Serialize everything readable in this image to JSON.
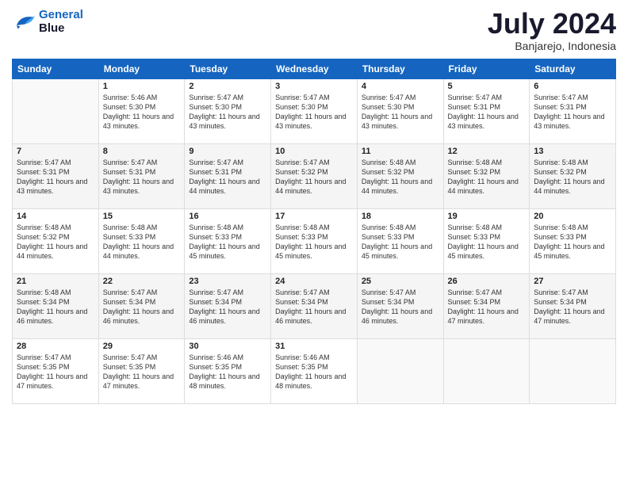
{
  "header": {
    "logo_line1": "General",
    "logo_line2": "Blue",
    "month": "July 2024",
    "location": "Banjarejo, Indonesia"
  },
  "days_of_week": [
    "Sunday",
    "Monday",
    "Tuesday",
    "Wednesday",
    "Thursday",
    "Friday",
    "Saturday"
  ],
  "weeks": [
    [
      {
        "day": "",
        "empty": true
      },
      {
        "day": "1",
        "sunrise": "Sunrise: 5:46 AM",
        "sunset": "Sunset: 5:30 PM",
        "daylight": "Daylight: 11 hours and 43 minutes."
      },
      {
        "day": "2",
        "sunrise": "Sunrise: 5:47 AM",
        "sunset": "Sunset: 5:30 PM",
        "daylight": "Daylight: 11 hours and 43 minutes."
      },
      {
        "day": "3",
        "sunrise": "Sunrise: 5:47 AM",
        "sunset": "Sunset: 5:30 PM",
        "daylight": "Daylight: 11 hours and 43 minutes."
      },
      {
        "day": "4",
        "sunrise": "Sunrise: 5:47 AM",
        "sunset": "Sunset: 5:30 PM",
        "daylight": "Daylight: 11 hours and 43 minutes."
      },
      {
        "day": "5",
        "sunrise": "Sunrise: 5:47 AM",
        "sunset": "Sunset: 5:31 PM",
        "daylight": "Daylight: 11 hours and 43 minutes."
      },
      {
        "day": "6",
        "sunrise": "Sunrise: 5:47 AM",
        "sunset": "Sunset: 5:31 PM",
        "daylight": "Daylight: 11 hours and 43 minutes."
      }
    ],
    [
      {
        "day": "7",
        "sunrise": "Sunrise: 5:47 AM",
        "sunset": "Sunset: 5:31 PM",
        "daylight": "Daylight: 11 hours and 43 minutes."
      },
      {
        "day": "8",
        "sunrise": "Sunrise: 5:47 AM",
        "sunset": "Sunset: 5:31 PM",
        "daylight": "Daylight: 11 hours and 43 minutes."
      },
      {
        "day": "9",
        "sunrise": "Sunrise: 5:47 AM",
        "sunset": "Sunset: 5:31 PM",
        "daylight": "Daylight: 11 hours and 44 minutes."
      },
      {
        "day": "10",
        "sunrise": "Sunrise: 5:47 AM",
        "sunset": "Sunset: 5:32 PM",
        "daylight": "Daylight: 11 hours and 44 minutes."
      },
      {
        "day": "11",
        "sunrise": "Sunrise: 5:48 AM",
        "sunset": "Sunset: 5:32 PM",
        "daylight": "Daylight: 11 hours and 44 minutes."
      },
      {
        "day": "12",
        "sunrise": "Sunrise: 5:48 AM",
        "sunset": "Sunset: 5:32 PM",
        "daylight": "Daylight: 11 hours and 44 minutes."
      },
      {
        "day": "13",
        "sunrise": "Sunrise: 5:48 AM",
        "sunset": "Sunset: 5:32 PM",
        "daylight": "Daylight: 11 hours and 44 minutes."
      }
    ],
    [
      {
        "day": "14",
        "sunrise": "Sunrise: 5:48 AM",
        "sunset": "Sunset: 5:32 PM",
        "daylight": "Daylight: 11 hours and 44 minutes."
      },
      {
        "day": "15",
        "sunrise": "Sunrise: 5:48 AM",
        "sunset": "Sunset: 5:33 PM",
        "daylight": "Daylight: 11 hours and 44 minutes."
      },
      {
        "day": "16",
        "sunrise": "Sunrise: 5:48 AM",
        "sunset": "Sunset: 5:33 PM",
        "daylight": "Daylight: 11 hours and 45 minutes."
      },
      {
        "day": "17",
        "sunrise": "Sunrise: 5:48 AM",
        "sunset": "Sunset: 5:33 PM",
        "daylight": "Daylight: 11 hours and 45 minutes."
      },
      {
        "day": "18",
        "sunrise": "Sunrise: 5:48 AM",
        "sunset": "Sunset: 5:33 PM",
        "daylight": "Daylight: 11 hours and 45 minutes."
      },
      {
        "day": "19",
        "sunrise": "Sunrise: 5:48 AM",
        "sunset": "Sunset: 5:33 PM",
        "daylight": "Daylight: 11 hours and 45 minutes."
      },
      {
        "day": "20",
        "sunrise": "Sunrise: 5:48 AM",
        "sunset": "Sunset: 5:33 PM",
        "daylight": "Daylight: 11 hours and 45 minutes."
      }
    ],
    [
      {
        "day": "21",
        "sunrise": "Sunrise: 5:48 AM",
        "sunset": "Sunset: 5:34 PM",
        "daylight": "Daylight: 11 hours and 46 minutes."
      },
      {
        "day": "22",
        "sunrise": "Sunrise: 5:47 AM",
        "sunset": "Sunset: 5:34 PM",
        "daylight": "Daylight: 11 hours and 46 minutes."
      },
      {
        "day": "23",
        "sunrise": "Sunrise: 5:47 AM",
        "sunset": "Sunset: 5:34 PM",
        "daylight": "Daylight: 11 hours and 46 minutes."
      },
      {
        "day": "24",
        "sunrise": "Sunrise: 5:47 AM",
        "sunset": "Sunset: 5:34 PM",
        "daylight": "Daylight: 11 hours and 46 minutes."
      },
      {
        "day": "25",
        "sunrise": "Sunrise: 5:47 AM",
        "sunset": "Sunset: 5:34 PM",
        "daylight": "Daylight: 11 hours and 46 minutes."
      },
      {
        "day": "26",
        "sunrise": "Sunrise: 5:47 AM",
        "sunset": "Sunset: 5:34 PM",
        "daylight": "Daylight: 11 hours and 47 minutes."
      },
      {
        "day": "27",
        "sunrise": "Sunrise: 5:47 AM",
        "sunset": "Sunset: 5:34 PM",
        "daylight": "Daylight: 11 hours and 47 minutes."
      }
    ],
    [
      {
        "day": "28",
        "sunrise": "Sunrise: 5:47 AM",
        "sunset": "Sunset: 5:35 PM",
        "daylight": "Daylight: 11 hours and 47 minutes."
      },
      {
        "day": "29",
        "sunrise": "Sunrise: 5:47 AM",
        "sunset": "Sunset: 5:35 PM",
        "daylight": "Daylight: 11 hours and 47 minutes."
      },
      {
        "day": "30",
        "sunrise": "Sunrise: 5:46 AM",
        "sunset": "Sunset: 5:35 PM",
        "daylight": "Daylight: 11 hours and 48 minutes."
      },
      {
        "day": "31",
        "sunrise": "Sunrise: 5:46 AM",
        "sunset": "Sunset: 5:35 PM",
        "daylight": "Daylight: 11 hours and 48 minutes."
      },
      {
        "day": "",
        "empty": true
      },
      {
        "day": "",
        "empty": true
      },
      {
        "day": "",
        "empty": true
      }
    ]
  ]
}
